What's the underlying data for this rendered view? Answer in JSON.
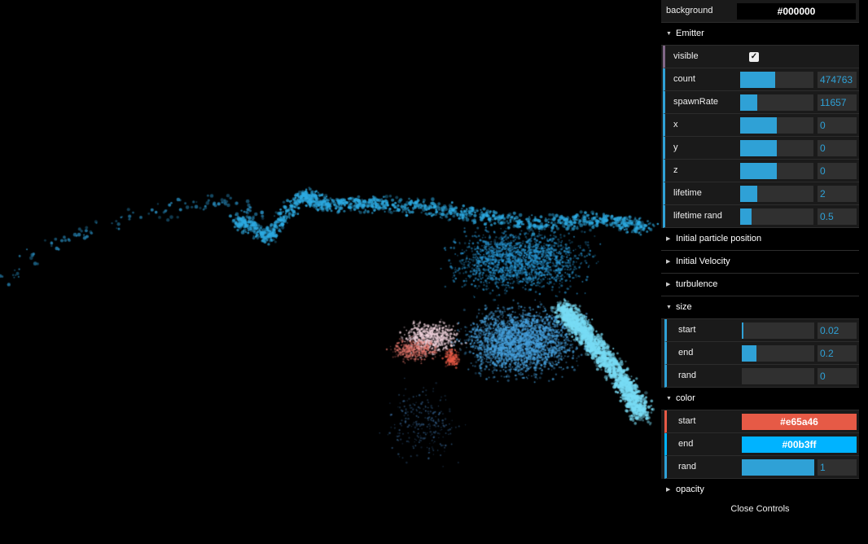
{
  "gui": {
    "background": {
      "label": "background",
      "value": "#000000"
    },
    "emitter": {
      "title": "Emitter",
      "visible": {
        "label": "visible",
        "checked": true
      },
      "sliders": [
        {
          "key": "count",
          "label": "count",
          "value": "474763",
          "fraction": 0.48
        },
        {
          "key": "spawnRate",
          "label": "spawnRate",
          "value": "11657",
          "fraction": 0.23
        },
        {
          "key": "x",
          "label": "x",
          "value": "0",
          "fraction": 0.5
        },
        {
          "key": "y",
          "label": "y",
          "value": "0",
          "fraction": 0.5
        },
        {
          "key": "z",
          "label": "z",
          "value": "0",
          "fraction": 0.5
        },
        {
          "key": "lifetime",
          "label": "lifetime",
          "value": "2",
          "fraction": 0.23
        },
        {
          "key": "lifetime-rand",
          "label": "lifetime rand",
          "value": "0.5",
          "fraction": 0.15
        }
      ]
    },
    "folders_closed": [
      "Initial particle position",
      "Initial Velocity",
      "turbulence"
    ],
    "size": {
      "title": "size",
      "sliders": [
        {
          "key": "start",
          "label": "start",
          "value": "0.02",
          "fraction": 0.02
        },
        {
          "key": "end",
          "label": "end",
          "value": "0.2",
          "fraction": 0.2
        },
        {
          "key": "rand",
          "label": "rand",
          "value": "0",
          "fraction": 0
        }
      ]
    },
    "color": {
      "title": "color",
      "start": {
        "label": "start",
        "value": "#e65a46"
      },
      "end": {
        "label": "end",
        "value": "#00b3ff"
      },
      "rand": {
        "label": "rand",
        "value": "1",
        "fraction": 1.0
      }
    },
    "opacity": {
      "title": "opacity"
    },
    "close_label": "Close Controls"
  },
  "colors": {
    "accent": "#2fa1d6",
    "particle_start": "#e65a46",
    "particle_end": "#00b3ff"
  }
}
